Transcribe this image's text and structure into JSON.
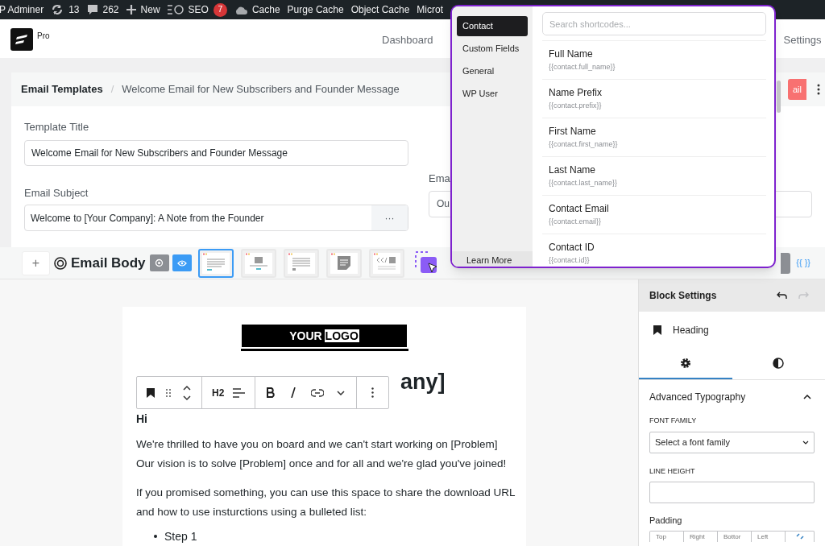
{
  "admin_bar": {
    "items": [
      {
        "kind": "text",
        "label": "P Adminer"
      },
      {
        "kind": "updates",
        "label": "13"
      },
      {
        "kind": "comments",
        "label": "262"
      },
      {
        "kind": "new",
        "label": "New"
      },
      {
        "kind": "seo",
        "label": "SEO",
        "badge": "7"
      },
      {
        "kind": "cloud",
        "label": "Cache"
      },
      {
        "kind": "text",
        "label": "Purge Cache"
      },
      {
        "kind": "text",
        "label": "Object Cache"
      },
      {
        "kind": "text",
        "label": "Microt"
      }
    ]
  },
  "header": {
    "logo_badge": "Pro",
    "nav": [
      {
        "label": "Dashboard"
      },
      {
        "label": "Settings"
      }
    ]
  },
  "breadcrumb": {
    "root": "Email Templates",
    "separator": "/",
    "current": "Welcome Email for New Subscribers and Founder Message",
    "action_button": "ail"
  },
  "form": {
    "template_title": {
      "label": "Template Title",
      "value": "Welcome Email for New Subscribers and Founder Message"
    },
    "email_subject": {
      "label": "Email Subject",
      "value": "Welcome to [Your Company]: A Note from the Founder",
      "more": "···"
    },
    "column_2": {
      "label": "Ema",
      "value": "Ou"
    }
  },
  "body_toolbar": {
    "add_button": "+",
    "title": "Email Body",
    "templates": [
      {
        "kind": "text",
        "selected": true
      },
      {
        "kind": "image",
        "selected": false
      },
      {
        "kind": "list",
        "selected": false
      },
      {
        "kind": "note",
        "selected": false
      },
      {
        "kind": "code",
        "selected": false
      }
    ],
    "shortcode_button": "{{ }}"
  },
  "email": {
    "logo": {
      "word_1": "YOUR",
      "word_2": "LOGO"
    },
    "heading": "any]",
    "blocks": [
      {
        "kind": "bold",
        "text": "Hi"
      },
      {
        "kind": "paragraph",
        "text": "We're thrilled to have you on board and we can't start working on [Problem] Our vision is to solve [Problem] once and for all and we're glad you've joined!"
      },
      {
        "kind": "paragraph",
        "text": "If you promised something, you can use this space to share the download URL and how to use insturctions using a bulleted list:"
      },
      {
        "kind": "bullet",
        "text": "Step 1"
      }
    ]
  },
  "block_toolbar": {
    "heading_level": "H2"
  },
  "block_settings": {
    "title": "Block Settings",
    "block": "Heading",
    "tabs": [
      {
        "kind": "settings",
        "selected": true
      },
      {
        "kind": "style",
        "selected": false
      }
    ],
    "section": {
      "title": "Advanced Typography",
      "expanded": true
    },
    "font_family": {
      "label": "FONT FAMILY",
      "value": "Select a font family"
    },
    "line_height": {
      "label": "LINE HEIGHT"
    },
    "padding": {
      "label": "Padding",
      "sides": [
        "Top",
        "Right",
        "Bottor",
        "Left"
      ]
    }
  },
  "shortcode_popover": {
    "categories": [
      {
        "label": "Contact",
        "selected": true
      },
      {
        "label": "Custom Fields",
        "selected": false
      },
      {
        "label": "General",
        "selected": false
      },
      {
        "label": "WP User",
        "selected": false
      }
    ],
    "learn_more": "Learn More",
    "search_placeholder": "Search shortcodes...",
    "items": [
      {
        "name": "Full Name",
        "code": "{{contact.full_name}}"
      },
      {
        "name": "Name Prefix",
        "code": "{{contact.prefix}}"
      },
      {
        "name": "First Name",
        "code": "{{contact.first_name}}"
      },
      {
        "name": "Last Name",
        "code": "{{contact.last_name}}"
      },
      {
        "name": "Contact Email",
        "code": "{{contact.email}}"
      },
      {
        "name": "Contact ID",
        "code": "{{contact.id}}"
      }
    ]
  }
}
